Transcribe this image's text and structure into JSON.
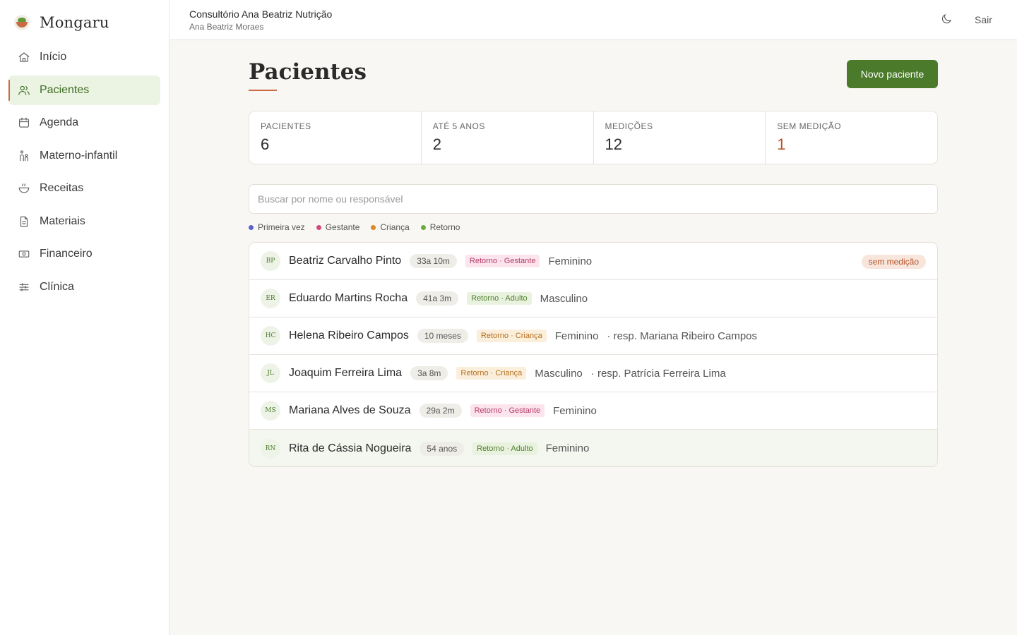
{
  "brand": {
    "name": "Mongaru"
  },
  "sidebar": {
    "items": [
      {
        "label": "Início",
        "icon": "home-icon",
        "active": false
      },
      {
        "label": "Pacientes",
        "icon": "users-icon",
        "active": true
      },
      {
        "label": "Agenda",
        "icon": "calendar-icon",
        "active": false
      },
      {
        "label": "Materno-infantil",
        "icon": "mother-child-icon",
        "active": false
      },
      {
        "label": "Receitas",
        "icon": "bowl-icon",
        "active": false
      },
      {
        "label": "Materiais",
        "icon": "document-icon",
        "active": false
      },
      {
        "label": "Financeiro",
        "icon": "money-icon",
        "active": false
      },
      {
        "label": "Clínica",
        "icon": "sliders-icon",
        "active": false
      }
    ]
  },
  "header": {
    "clinic_name": "Consultório Ana Beatriz Nutrição",
    "user_name": "Ana Beatriz Moraes",
    "theme_icon": "moon-icon",
    "logout_label": "Sair"
  },
  "main": {
    "title": "Pacientes",
    "new_button_label": "Novo paciente",
    "stats": [
      {
        "label": "PACIENTES",
        "value": "6"
      },
      {
        "label": "ATÉ 5 ANOS",
        "value": "2"
      },
      {
        "label": "MEDIÇÕES",
        "value": "12"
      },
      {
        "label": "SEM MEDIÇÃO",
        "value": "1"
      }
    ],
    "search": {
      "placeholder": "Buscar por nome ou responsável",
      "value": ""
    },
    "legend": [
      {
        "label": "Primeira vez",
        "color": "#5a64c8"
      },
      {
        "label": "Gestante",
        "color": "#d04a82"
      },
      {
        "label": "Criança",
        "color": "#d9882a"
      },
      {
        "label": "Retorno",
        "color": "#6aab3c"
      }
    ],
    "patients": [
      {
        "initials": "BP",
        "name": "Beatriz Carvalho Pinto",
        "age": "33a 10m",
        "tag": "Retorno · Gestante",
        "sex": "Feminino",
        "resp": "",
        "badge": "sem medição"
      },
      {
        "initials": "ER",
        "name": "Eduardo Martins Rocha",
        "age": "41a 3m",
        "tag": "Retorno · Adulto",
        "sex": "Masculino",
        "resp": "",
        "badge": ""
      },
      {
        "initials": "HC",
        "name": "Helena Ribeiro Campos",
        "age": "10 meses",
        "tag": "Retorno · Criança",
        "sex": "Feminino",
        "resp": "· resp. Mariana Ribeiro Campos",
        "badge": ""
      },
      {
        "initials": "JL",
        "name": "Joaquim Ferreira Lima",
        "age": "3a 8m",
        "tag": "Retorno · Criança",
        "sex": "Masculino",
        "resp": "· resp. Patrícia Ferreira Lima",
        "badge": ""
      },
      {
        "initials": "MS",
        "name": "Mariana Alves de Souza",
        "age": "29a 2m",
        "tag": "Retorno · Gestante",
        "sex": "Feminino",
        "resp": "",
        "badge": ""
      },
      {
        "initials": "RN",
        "name": "Rita de Cássia Nogueira",
        "age": "54 anos",
        "tag": "Retorno · Adulto",
        "sex": "Feminino",
        "resp": "",
        "badge": ""
      }
    ]
  }
}
